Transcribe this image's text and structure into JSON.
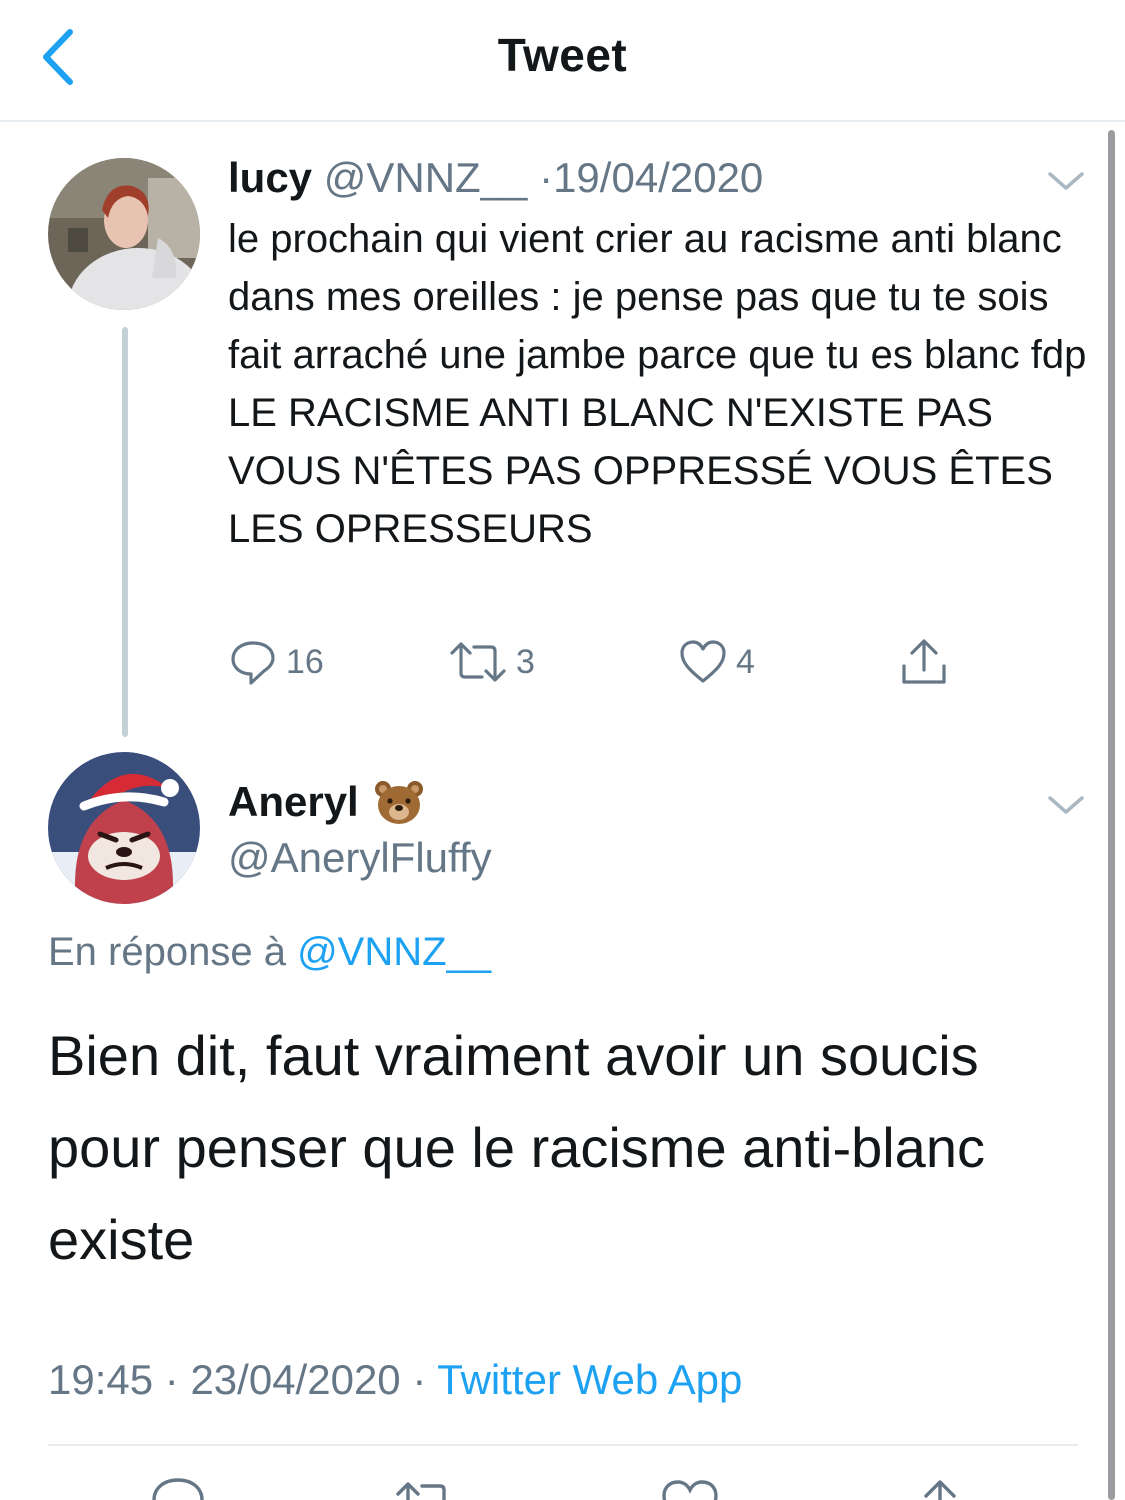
{
  "header": {
    "title": "Tweet",
    "back_icon": "chevron-left-icon"
  },
  "colors": {
    "accent": "#1da1f2",
    "text": "#14171a",
    "muted": "#657786",
    "divider": "#e6ecf0"
  },
  "parent_tweet": {
    "name": "lucy",
    "handle": "@VNNZ__",
    "separator": "·",
    "date": "19/04/2020",
    "text_lines": [
      "le prochain qui vient crier au racisme anti blanc dans mes oreilles : je pense pas que tu te sois fait arraché une jambe parce que tu es blanc fdp",
      "LE RACISME ANTI BLANC N'EXISTE PAS VOUS N'ÊTES PAS OPPRESSÉ VOUS ÊTES LES OPRESSEURS"
    ],
    "actions": {
      "replies": "16",
      "retweets": "3",
      "likes": "4"
    }
  },
  "main_tweet": {
    "name": "Aneryl",
    "name_emoji": "bear-face-emoji",
    "handle": "@AnerylFluffy",
    "reply_prefix": "En réponse à",
    "reply_to": "@VNNZ__",
    "text": "Bien dit, faut vraiment avoir un soucis pour penser que le racisme anti-blanc existe",
    "time": "19:45",
    "separator": "·",
    "date": "23/04/2020",
    "source": "Twitter Web App"
  }
}
